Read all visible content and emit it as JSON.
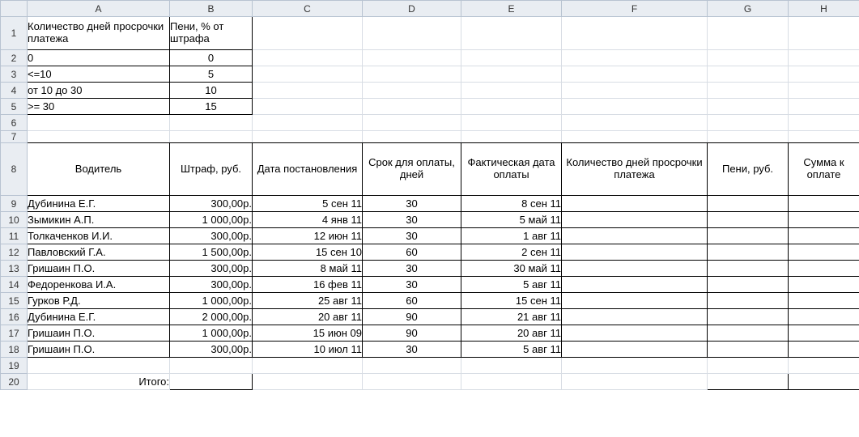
{
  "columns": [
    "A",
    "B",
    "C",
    "D",
    "E",
    "F",
    "G",
    "H"
  ],
  "rows": [
    "1",
    "2",
    "3",
    "4",
    "5",
    "6",
    "7",
    "8",
    "9",
    "10",
    "11",
    "12",
    "13",
    "14",
    "15",
    "16",
    "17",
    "18",
    "19",
    "20"
  ],
  "top": {
    "h1": "Количество дней просрочки платежа",
    "h2": "Пени, % от штрафа",
    "r": [
      {
        "a": "0",
        "b": "0"
      },
      {
        "a": "<=10",
        "b": "5"
      },
      {
        "a": "от 10 до 30",
        "b": "10"
      },
      {
        "a": ">= 30",
        "b": "15"
      }
    ]
  },
  "main": {
    "headers": {
      "driver": "Водитель",
      "fine": "Штраф, руб.",
      "decree_date": "Дата постановления",
      "pay_term": "Срок для оплаты, дней",
      "actual_date": "Фактическая дата оплаты",
      "overdue": "Количество дней просрочки платежа",
      "peni": "Пени, руб.",
      "total": "Сумма к оплате"
    },
    "rows": [
      {
        "driver": "Дубинина Е.Г.",
        "fine": "300,00р.",
        "decree": "5 сен 11",
        "term": "30",
        "actual": "8 сен 11"
      },
      {
        "driver": "Зымикин А.П.",
        "fine": "1 000,00р.",
        "decree": "4 янв 11",
        "term": "30",
        "actual": "5 май 11"
      },
      {
        "driver": "Толкаченков И.И.",
        "fine": "300,00р.",
        "decree": "12 июн 11",
        "term": "30",
        "actual": "1 авг 11"
      },
      {
        "driver": "Павловский Г.А.",
        "fine": "1 500,00р.",
        "decree": "15 сен 10",
        "term": "60",
        "actual": "2 сен 11"
      },
      {
        "driver": "Гришаин П.О.",
        "fine": "300,00р.",
        "decree": "8 май 11",
        "term": "30",
        "actual": "30 май 11"
      },
      {
        "driver": "Федоренкова И.А.",
        "fine": "300,00р.",
        "decree": "16 фев 11",
        "term": "30",
        "actual": "5 авг 11"
      },
      {
        "driver": "Гурков Р.Д.",
        "fine": "1 000,00р.",
        "decree": "25 авг 11",
        "term": "60",
        "actual": "15 сен 11"
      },
      {
        "driver": "Дубинина Е.Г.",
        "fine": "2 000,00р.",
        "decree": "20 авг 11",
        "term": "90",
        "actual": "21 авг 11"
      },
      {
        "driver": "Гришаин П.О.",
        "fine": "1 000,00р.",
        "decree": "15 июн 09",
        "term": "90",
        "actual": "20 авг 11"
      },
      {
        "driver": "Гришаин П.О.",
        "fine": "300,00р.",
        "decree": "10 июл 11",
        "term": "30",
        "actual": "5 авг 11"
      }
    ],
    "total_label": "Итого:"
  }
}
